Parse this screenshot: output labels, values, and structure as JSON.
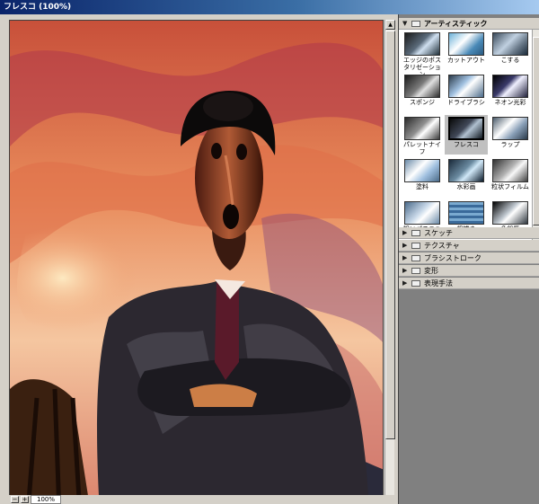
{
  "window": {
    "title": "フレスコ (100%)"
  },
  "status": {
    "zoom": "100%",
    "minus": "−",
    "plus": "+"
  },
  "panel": {
    "open_category": "アーティスティック",
    "filters": [
      {
        "label": "エッジのポスタリゼーション",
        "icon": "poster-edges-thumb"
      },
      {
        "label": "カットアウト",
        "icon": "cutout-thumb"
      },
      {
        "label": "こする",
        "icon": "smudge-stick-thumb"
      },
      {
        "label": "スポンジ",
        "icon": "sponge-thumb"
      },
      {
        "label": "ドライブラシ",
        "icon": "dry-brush-thumb"
      },
      {
        "label": "ネオン光彩",
        "icon": "neon-glow-thumb"
      },
      {
        "label": "パレットナイフ",
        "icon": "palette-knife-thumb"
      },
      {
        "label": "フレスコ",
        "icon": "fresco-thumb",
        "selected": true
      },
      {
        "label": "ラップ",
        "icon": "plastic-wrap-thumb"
      },
      {
        "label": "塗料",
        "icon": "paint-daubs-thumb"
      },
      {
        "label": "水彩画",
        "icon": "watercolor-thumb"
      },
      {
        "label": "粒状フィルム",
        "icon": "film-grain-thumb"
      },
      {
        "label": "粗いパステル画",
        "icon": "rough-pastels-thumb"
      },
      {
        "label": "粗描き",
        "icon": "underpainting-thumb"
      },
      {
        "label": "色鉛筆",
        "icon": "colored-pencil-thumb"
      }
    ],
    "categories": [
      {
        "label": "スケッチ"
      },
      {
        "label": "テクスチャ"
      },
      {
        "label": "ブラシストローク"
      },
      {
        "label": "変形"
      },
      {
        "label": "表現手法"
      }
    ]
  },
  "icons": {
    "open": "triangle-down-icon",
    "closed": "triangle-right-icon",
    "folder": "folder-icon"
  },
  "colors": {
    "titlebar_start": "#0a246a",
    "panel_bg": "#808080",
    "selected_bg": "#c0c0c0"
  }
}
